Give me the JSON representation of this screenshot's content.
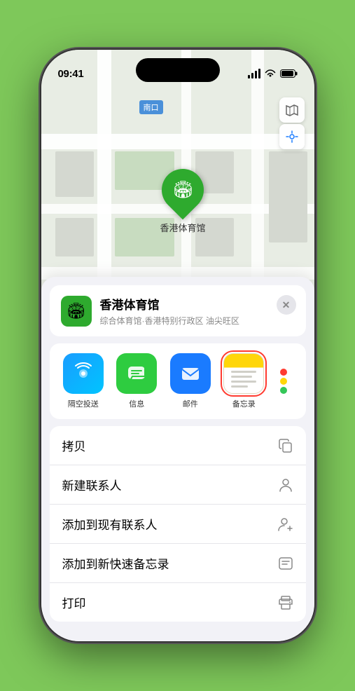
{
  "status_bar": {
    "time": "09:41",
    "location_arrow": "▶"
  },
  "map": {
    "label": "南口",
    "pin_label": "香港体育馆",
    "controls": {
      "map_icon": "🗺",
      "location_icon": "⊕"
    }
  },
  "location_header": {
    "name": "香港体育馆",
    "subtitle": "综合体育馆·香港特别行政区 油尖旺区",
    "close_label": "✕"
  },
  "share_items": [
    {
      "id": "airdrop",
      "label": "隔空投送",
      "type": "airdrop"
    },
    {
      "id": "message",
      "label": "信息",
      "type": "message"
    },
    {
      "id": "mail",
      "label": "邮件",
      "type": "mail"
    },
    {
      "id": "notes",
      "label": "备忘录",
      "type": "notes",
      "selected": true
    }
  ],
  "more_dots": {
    "colors": [
      "#ff3b30",
      "#ffd60a",
      "#34c759"
    ]
  },
  "action_items": [
    {
      "id": "copy",
      "label": "拷贝",
      "icon": "copy"
    },
    {
      "id": "new-contact",
      "label": "新建联系人",
      "icon": "person"
    },
    {
      "id": "add-contact",
      "label": "添加到现有联系人",
      "icon": "person-add"
    },
    {
      "id": "quick-note",
      "label": "添加到新快速备忘录",
      "icon": "note"
    },
    {
      "id": "print",
      "label": "打印",
      "icon": "printer"
    }
  ]
}
